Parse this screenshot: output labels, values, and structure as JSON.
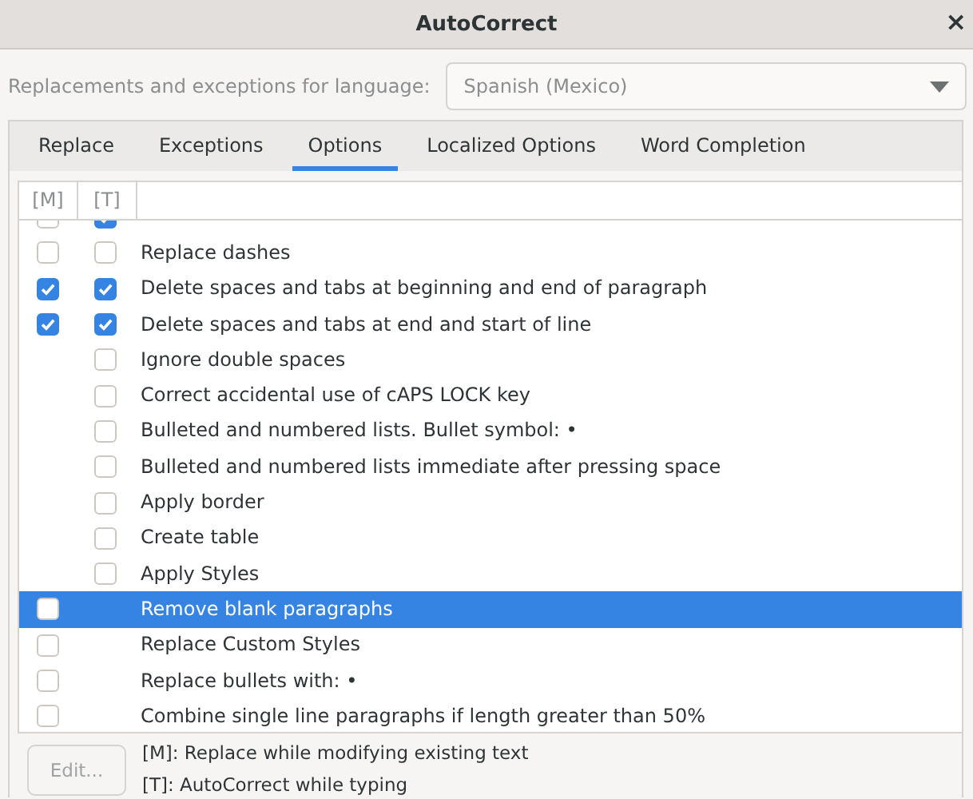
{
  "window": {
    "title": "AutoCorrect",
    "close": "×"
  },
  "language": {
    "label": "Replacements and exceptions for language:",
    "value": "Spanish (Mexico)"
  },
  "tabs": [
    {
      "label": "Replace",
      "selected": false
    },
    {
      "label": "Exceptions",
      "selected": false
    },
    {
      "label": "Options",
      "selected": true
    },
    {
      "label": "Localized Options",
      "selected": false
    },
    {
      "label": "Word Completion",
      "selected": false
    }
  ],
  "columns": [
    "[M]",
    "[T]"
  ],
  "rows": [
    {
      "m_checked": false,
      "t_checked": true,
      "selected": false
    },
    {
      "label": "Replace dashes",
      "m_checked": false,
      "t_checked": false,
      "selected": false
    },
    {
      "label": "Delete spaces and tabs at beginning and end of paragraph",
      "m_checked": true,
      "t_checked": true,
      "selected": false
    },
    {
      "label": "Delete spaces and tabs at end and start of line",
      "m_checked": true,
      "t_checked": true,
      "selected": false
    },
    {
      "label": "Ignore double spaces",
      "t_checked": false,
      "selected": false
    },
    {
      "label": "Correct accidental use of cAPS LOCK key",
      "t_checked": false,
      "selected": false
    },
    {
      "label": "Bulleted and numbered lists. Bullet symbol: •",
      "t_checked": false,
      "selected": false
    },
    {
      "label": "Bulleted and numbered lists immediate after pressing space",
      "t_checked": false,
      "selected": false
    },
    {
      "label": "Apply border",
      "t_checked": false,
      "selected": false
    },
    {
      "label": "Create table",
      "t_checked": false,
      "selected": false
    },
    {
      "label": "Apply Styles",
      "t_checked": false,
      "selected": false
    },
    {
      "label": "Remove blank paragraphs",
      "m_checked": false,
      "selected": true
    },
    {
      "label": "Replace Custom Styles",
      "m_checked": false,
      "selected": false
    },
    {
      "label": "Replace bullets with: •",
      "m_checked": false,
      "selected": false
    },
    {
      "label": "Combine single line paragraphs if length greater than 50%",
      "m_checked": false,
      "selected": false
    }
  ],
  "edit_button": {
    "label": "Edit...",
    "disabled": true
  },
  "legend": [
    "[M]: Replace while modifying existing text",
    "[T]: AutoCorrect while typing"
  ]
}
